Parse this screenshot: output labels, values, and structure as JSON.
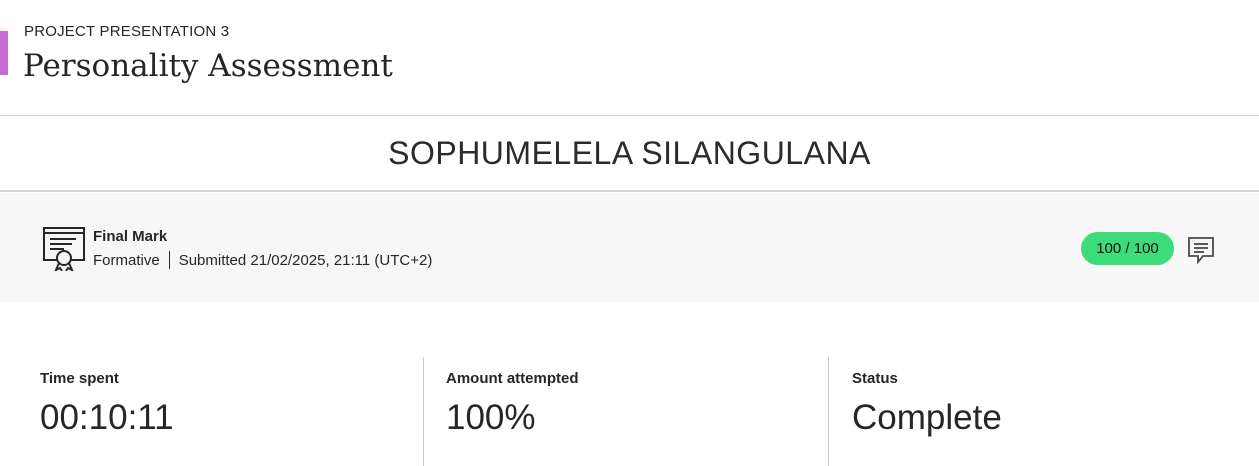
{
  "header": {
    "eyebrow": "PROJECT PRESENTATION 3",
    "title": "Personality Assessment",
    "accent_color": "#c96bd6"
  },
  "student": {
    "name": "SOPHUMELELA SILANGULANA"
  },
  "grade": {
    "icon": "certificate-icon",
    "title": "Final Mark",
    "type": "Formative",
    "submitted": "Submitted 21/02/2025, 21:11 (UTC+2)",
    "score": "100 / 100",
    "score_color": "#3ddc7a",
    "feedback_icon": "feedback-icon"
  },
  "stats": [
    {
      "label": "Time spent",
      "value": "00:10:11"
    },
    {
      "label": "Amount attempted",
      "value": "100%"
    },
    {
      "label": "Status",
      "value": "Complete"
    }
  ]
}
